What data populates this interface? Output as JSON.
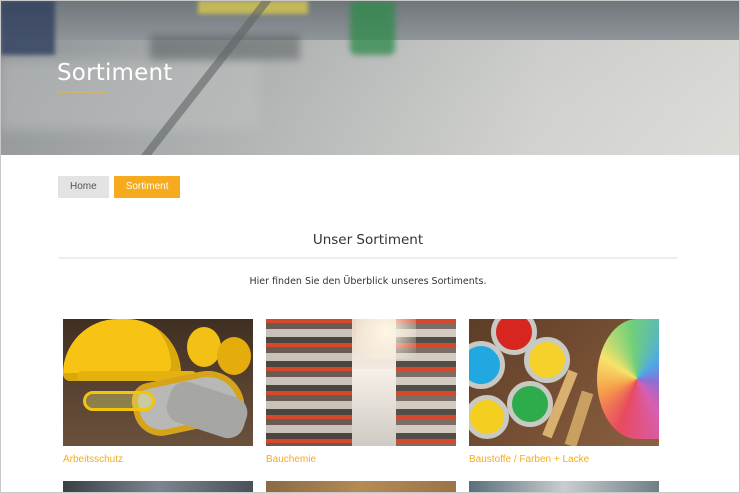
{
  "hero": {
    "title": "Sortiment"
  },
  "breadcrumb": {
    "home": "Home",
    "current": "Sortiment"
  },
  "section": {
    "title": "Unser Sortiment",
    "intro": "Hier finden Sie den Überblick unseres Sortiments."
  },
  "categories": [
    {
      "label": "Arbeitsschutz",
      "image": "safety-gear-image"
    },
    {
      "label": "Bauchemie",
      "image": "store-aisle-image"
    },
    {
      "label": "Baustoffe / Farben + Lacke",
      "image": "paint-cans-image"
    }
  ],
  "colors": {
    "accent": "#f5ab1d",
    "breadcrumb_home_bg": "#e3e3e3",
    "hero_title": "#ffffff"
  }
}
